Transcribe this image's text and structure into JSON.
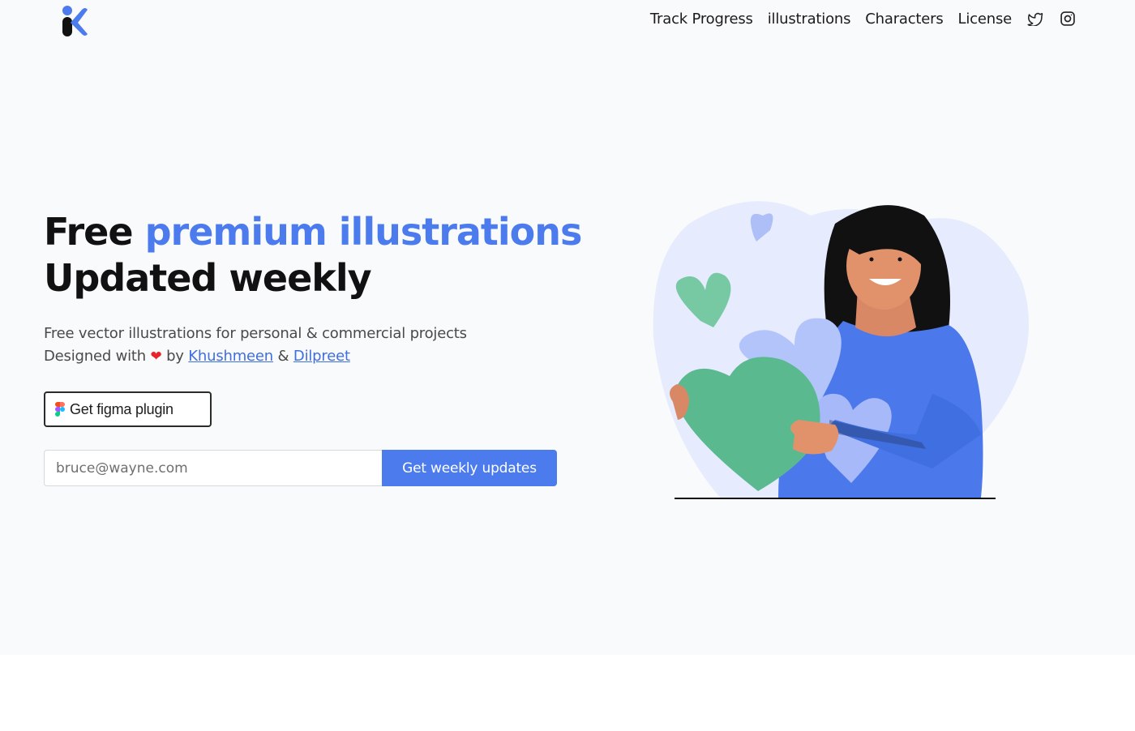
{
  "nav": {
    "items": [
      "Track Progress",
      "illustrations",
      "Characters",
      "License"
    ],
    "social": [
      "twitter-icon",
      "instagram-icon"
    ]
  },
  "hero": {
    "title_prefix": "Free",
    "title_accent": "premium illustrations",
    "title_line2": "Updated weekly",
    "subtitle_line1": "Free vector illustrations for personal & commercial projects",
    "designed_with": "Designed with",
    "by": "by",
    "author1": "Khushmeen",
    "amp": "&",
    "author2": "Dilpreet"
  },
  "figma_button": {
    "label": "Get figma plugin",
    "icon": "figma-icon"
  },
  "subscribe": {
    "placeholder": "bruce@wayne.com",
    "button_label": "Get weekly updates"
  },
  "colors": {
    "accent": "#4b7bec",
    "background": "#f9fafc",
    "heart_green": "#5bb990",
    "heart_lavender": "#b3c4fb"
  }
}
